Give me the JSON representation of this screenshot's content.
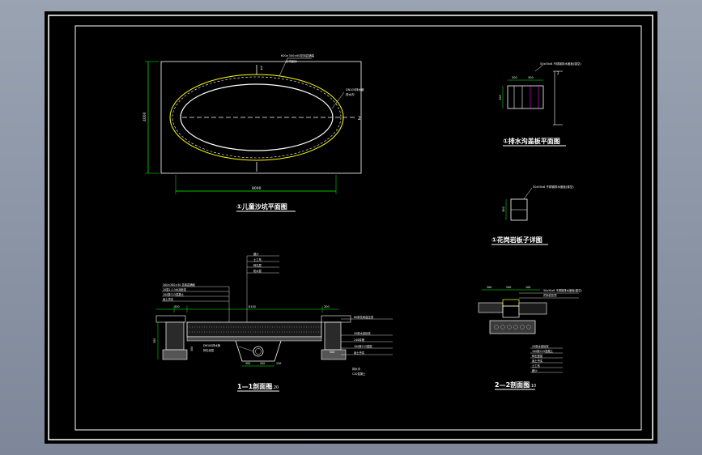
{
  "drawing": {
    "plan": {
      "title": "①儿童沙坑平面图",
      "dim_height": "4000",
      "dim_width": "8000",
      "section_mark": "1",
      "section_mark_2": "2",
      "note_1": "600×300×60花岗岩铺装",
      "note_2": "DN100排水管",
      "note_3": "排水沟",
      "note_4": "沙坑细沙"
    },
    "drain_plan": {
      "title": "①排水沟盖板平面图",
      "dim_a": "300",
      "dim_b": "300",
      "dim_c": "100",
      "note": "50x50x8 不锈钢排水盖板(镂空)",
      "mark": "2"
    },
    "granite_detail": {
      "title": "①花岗岩板子详图",
      "dim": "300",
      "note": "50x50x8 不锈钢排水盖板(镂空)"
    },
    "section_1": {
      "title": "1—1剖面图",
      "scale": "1:20",
      "dim_total": "8100",
      "dim_left": "300",
      "dim_right": "300",
      "dim_left_2": "300",
      "dim_h1": "300",
      "dim_h2": "200",
      "dim_h3": "150",
      "dim_v1": "200",
      "dim_v2": "300",
      "dim_v3": "500",
      "label_left_1": "300×300×30 花岗岩铺面",
      "label_left_2": "20厚1:2.5水泥砂浆",
      "label_left_3": "100厚C15混凝土",
      "label_left_4": "素土夯实",
      "label_top_1": "细沙",
      "label_top_2": "土工布",
      "label_top_3": "碎石层",
      "label_top_4": "防水层",
      "label_right_1": "60厚花岗岩压顶",
      "label_right_2": "20厚水泥砂浆",
      "label_right_3": "240砖墙",
      "label_right_4": "100厚C15垫层",
      "label_right_5": "素土夯实",
      "label_pipe_1": "DN100排水管",
      "label_pipe_2": "碎石滤层",
      "label_b_1": "排水沟",
      "label_b_2": "C20混凝土"
    },
    "section_2": {
      "title": "2—2剖面图",
      "scale": "1:10",
      "dim_a": "300",
      "dim_b": "200",
      "dim_c": "100",
      "label_1": "50x50x8 不锈钢排水盖板(镂空)",
      "label_2": "花岗岩压顶",
      "label_3": "20厚水泥砂浆",
      "label_4": "100厚C15混凝土",
      "label_5": "碎石垫层",
      "label_6": "素土夯实",
      "label_7": "土工布",
      "label_8": "细沙"
    }
  },
  "colors": {
    "canvas": "#000000",
    "line": "#ffffff",
    "dim": "#00ff00",
    "accent": "#ffff00",
    "note": "#ff00ff",
    "hatch": "#c8c8c8"
  }
}
